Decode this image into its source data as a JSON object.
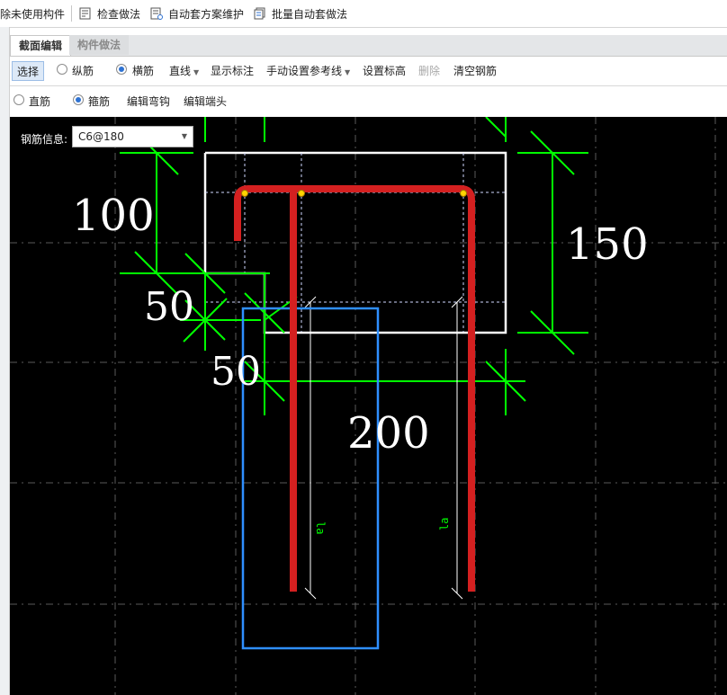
{
  "toolbar": {
    "items": [
      {
        "label": "除未使用构件",
        "icon": "delete-unused-icon"
      },
      {
        "label": "检查做法",
        "icon": "check-method-icon"
      },
      {
        "label": "自动套方案维护",
        "icon": "auto-scheme-icon"
      },
      {
        "label": "批量自动套做法",
        "icon": "batch-auto-icon"
      }
    ]
  },
  "tabs": [
    {
      "label": "截面编辑",
      "active": true
    },
    {
      "label": "构件做法",
      "active": false
    }
  ],
  "row2": {
    "select_label": "选择",
    "radio_longitudinal": "纵筋",
    "radio_transverse": "横筋",
    "line_type": "直线",
    "show_annotation": "显示标注",
    "manual_reference_line": "手动设置参考线",
    "set_elevation": "设置标高",
    "delete": "删除",
    "clear_rebar": "清空钢筋"
  },
  "row3": {
    "radio_straight": "直筋",
    "radio_stirrup": "箍筋",
    "edit_hook": "编辑弯钩",
    "edit_end": "编辑端头"
  },
  "rebar_info": {
    "label": "钢筋信息:",
    "value": "C6@180"
  },
  "drawing": {
    "dim_100": "100",
    "dim_150": "150",
    "dim_50_a": "50",
    "dim_50_b": "50",
    "dim_200": "200",
    "la_left": "la",
    "la_right": "la",
    "colors": {
      "background": "#000000",
      "dimension": "#00ff00",
      "rebar": "#d42020",
      "section_outline": "#ffffff",
      "highlight_box": "#2f8fff",
      "grid": "#5a5a5a"
    }
  }
}
